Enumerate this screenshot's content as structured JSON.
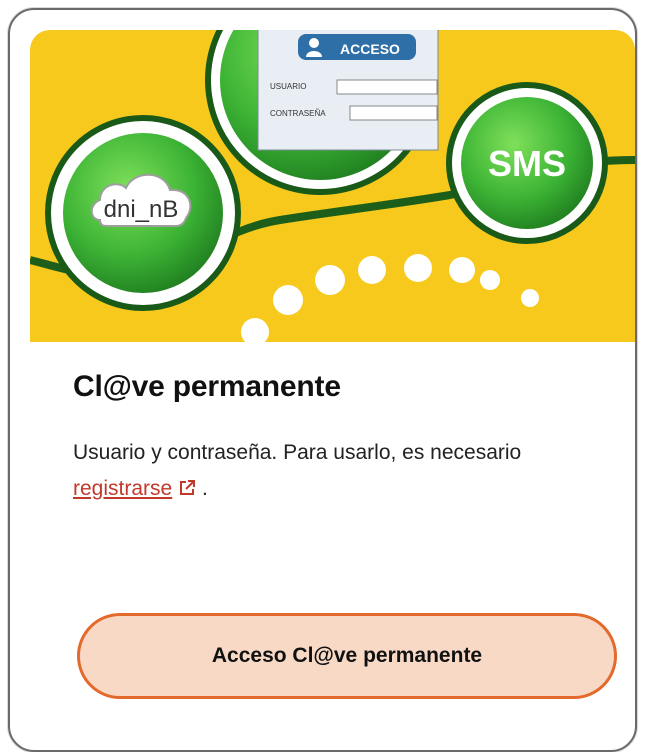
{
  "card": {
    "banner": {
      "cloud_label": "dni_nB",
      "sms_label": "SMS",
      "login_header": "ACCESO",
      "user_label": "USUARIO",
      "password_label": "CONTRASEÑA"
    },
    "title": "Cl@ve permanente",
    "description_prefix": "Usuario y contraseña. Para usarlo, es necesario ",
    "register_link": "registrarse",
    "description_suffix": " .",
    "access_button": "Acceso Cl@ve permanente"
  },
  "colors": {
    "banner_yellow": "#f7c91c",
    "green": "#3db03a",
    "button_fill": "#f7d9c6",
    "button_border": "#e46a2c",
    "link": "#c0392b"
  },
  "icons": {
    "external_link": "external-link-icon",
    "user": "user-icon"
  }
}
